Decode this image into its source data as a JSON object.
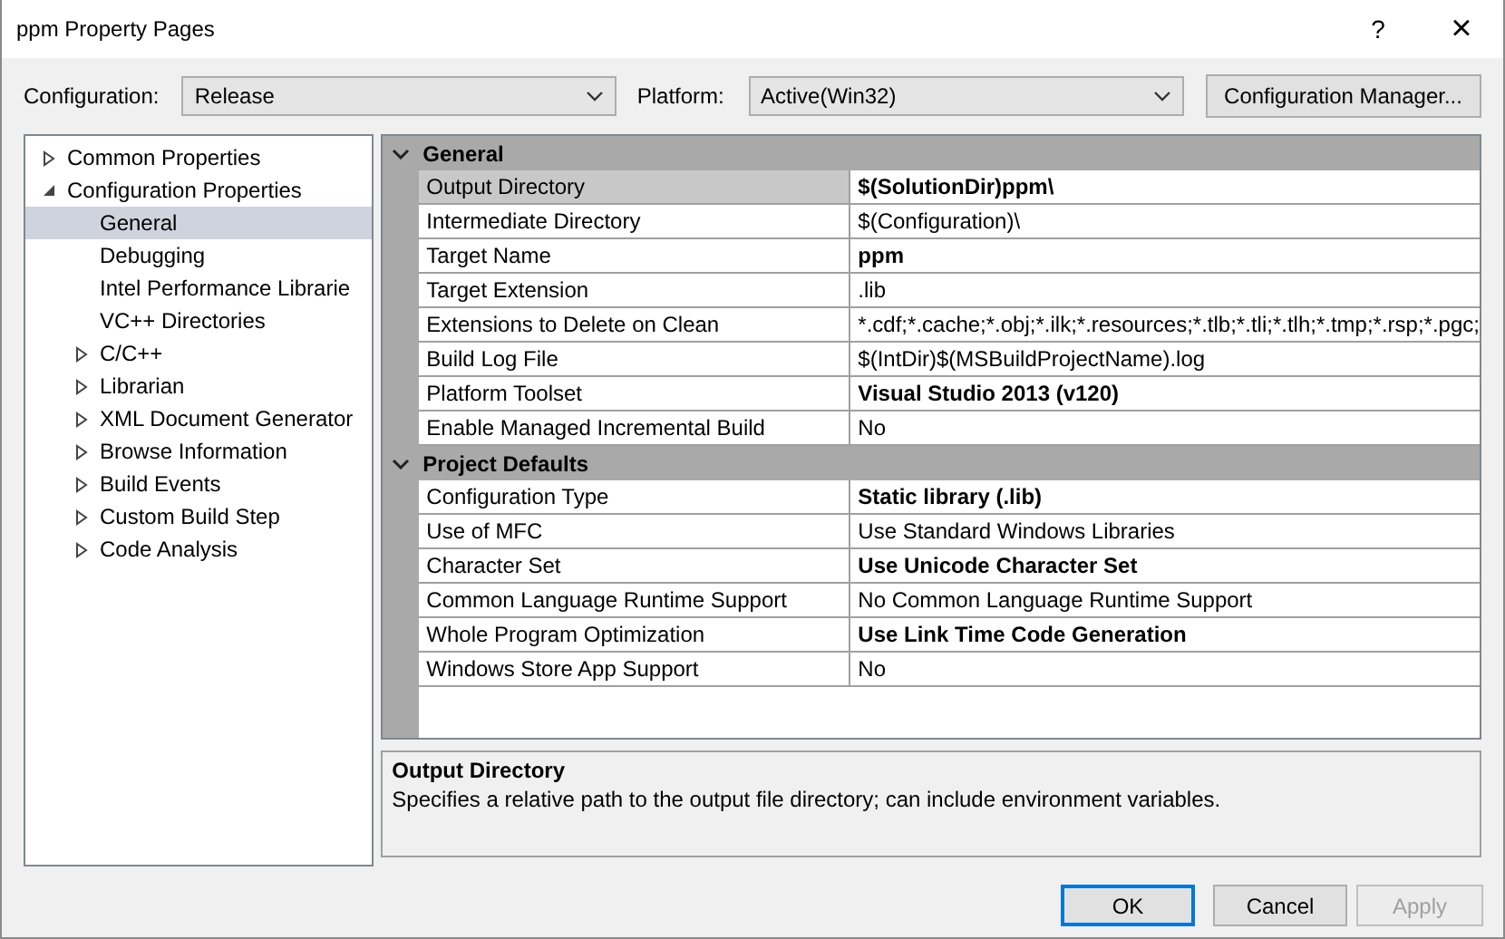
{
  "window": {
    "title": "ppm Property Pages",
    "help": "?",
    "close": "×"
  },
  "toolbar": {
    "configuration": {
      "label": "Configuration:",
      "value": "Release"
    },
    "platform": {
      "label": "Platform:",
      "value": "Active(Win32)"
    },
    "manager_button": "Configuration Manager..."
  },
  "tree": [
    {
      "label": "Common Properties",
      "expanded": false,
      "selected": false,
      "kind": "group"
    },
    {
      "label": "Configuration Properties",
      "expanded": true,
      "selected": false,
      "children": [
        {
          "label": "General",
          "selected": true,
          "kind": "leaf"
        },
        {
          "label": "Debugging",
          "selected": false,
          "kind": "leaf"
        },
        {
          "label": "Intel Performance Librarie",
          "selected": false,
          "kind": "leaf"
        },
        {
          "label": "VC++ Directories",
          "selected": false,
          "kind": "leaf"
        },
        {
          "label": "C/C++",
          "selected": false,
          "kind": "group",
          "expanded": false
        },
        {
          "label": "Librarian",
          "selected": false,
          "kind": "group",
          "expanded": false
        },
        {
          "label": "XML Document Generator",
          "selected": false,
          "kind": "group",
          "expanded": false
        },
        {
          "label": "Browse Information",
          "selected": false,
          "kind": "group",
          "expanded": false
        },
        {
          "label": "Build Events",
          "selected": false,
          "kind": "group",
          "expanded": false
        },
        {
          "label": "Custom Build Step",
          "selected": false,
          "kind": "group",
          "expanded": false
        },
        {
          "label": "Code Analysis",
          "selected": false,
          "kind": "group",
          "expanded": false
        }
      ]
    }
  ],
  "grid": [
    {
      "category": "General",
      "expanded": true,
      "rows": [
        {
          "name": "Output Directory",
          "value": "$(SolutionDir)ppm\\",
          "bold": true,
          "selected": true
        },
        {
          "name": "Intermediate Directory",
          "value": "$(Configuration)\\",
          "bold": false,
          "selected": false
        },
        {
          "name": "Target Name",
          "value": "ppm",
          "bold": true,
          "selected": false
        },
        {
          "name": "Target Extension",
          "value": ".lib",
          "bold": false,
          "selected": false
        },
        {
          "name": "Extensions to Delete on Clean",
          "value": "*.cdf;*.cache;*.obj;*.ilk;*.resources;*.tlb;*.tli;*.tlh;*.tmp;*.rsp;*.pgc;",
          "bold": false,
          "selected": false
        },
        {
          "name": "Build Log File",
          "value": "$(IntDir)$(MSBuildProjectName).log",
          "bold": false,
          "selected": false
        },
        {
          "name": "Platform Toolset",
          "value": "Visual Studio 2013 (v120)",
          "bold": true,
          "selected": false
        },
        {
          "name": "Enable Managed Incremental Build",
          "value": "No",
          "bold": false,
          "selected": false
        }
      ]
    },
    {
      "category": "Project Defaults",
      "expanded": true,
      "rows": [
        {
          "name": "Configuration Type",
          "value": "Static library (.lib)",
          "bold": true,
          "selected": false
        },
        {
          "name": "Use of MFC",
          "value": "Use Standard Windows Libraries",
          "bold": false,
          "selected": false
        },
        {
          "name": "Character Set",
          "value": "Use Unicode Character Set",
          "bold": true,
          "selected": false
        },
        {
          "name": "Common Language Runtime Support",
          "value": "No Common Language Runtime Support",
          "bold": false,
          "selected": false
        },
        {
          "name": "Whole Program Optimization",
          "value": "Use Link Time Code Generation",
          "bold": true,
          "selected": false
        },
        {
          "name": "Windows Store App Support",
          "value": "No",
          "bold": false,
          "selected": false
        }
      ]
    }
  ],
  "description": {
    "title": "Output Directory",
    "text": "Specifies a relative path to the output file directory; can include environment variables."
  },
  "buttons": [
    {
      "label": "OK",
      "default": true,
      "disabled": false
    },
    {
      "label": "Cancel",
      "default": false,
      "disabled": false
    },
    {
      "label": "Apply",
      "default": false,
      "disabled": true
    }
  ]
}
